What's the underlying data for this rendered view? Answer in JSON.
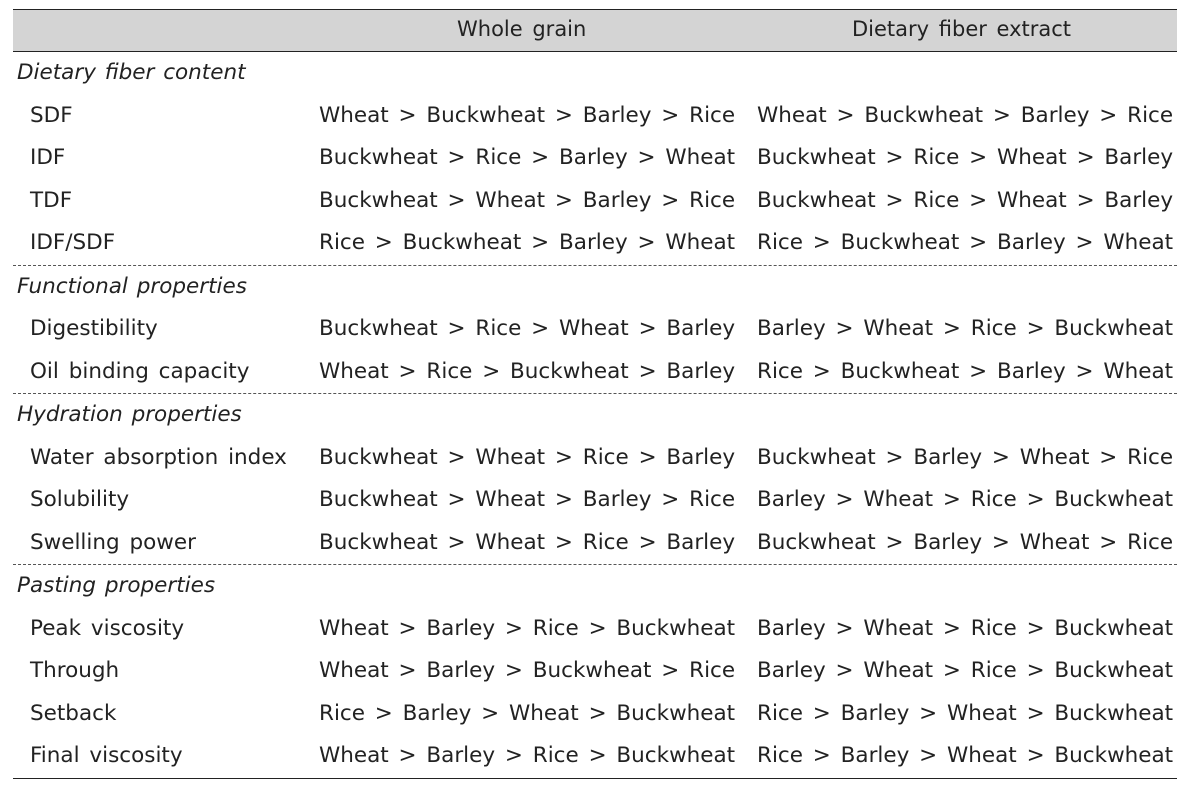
{
  "header": {
    "col_label": "",
    "col1": "Whole grain",
    "col2": "Dietary fiber extract"
  },
  "sections": [
    {
      "title": "Dietary fiber content",
      "rows": [
        {
          "label": "SDF",
          "whole": "Wheat > Buckwheat > Barley > Rice",
          "extract": "Wheat > Buckwheat > Barley > Rice"
        },
        {
          "label": "IDF",
          "whole": "Buckwheat > Rice > Barley > Wheat",
          "extract": "Buckwheat > Rice > Wheat > Barley"
        },
        {
          "label": "TDF",
          "whole": "Buckwheat > Wheat > Barley > Rice",
          "extract": "Buckwheat > Rice > Wheat > Barley"
        },
        {
          "label": "IDF/SDF",
          "whole": "Rice > Buckwheat > Barley > Wheat",
          "extract": "Rice > Buckwheat > Barley > Wheat"
        }
      ]
    },
    {
      "title": "Functional properties",
      "rows": [
        {
          "label": "Digestibility",
          "whole": "Buckwheat > Rice > Wheat > Barley",
          "extract": "Barley > Wheat > Rice > Buckwheat"
        },
        {
          "label": "Oil binding capacity",
          "whole": "Wheat > Rice > Buckwheat > Barley",
          "extract": "Rice > Buckwheat > Barley > Wheat"
        }
      ]
    },
    {
      "title": "Hydration properties",
      "rows": [
        {
          "label": "Water absorption index",
          "whole": "Buckwheat > Wheat > Rice > Barley",
          "extract": "Buckwheat > Barley > Wheat > Rice"
        },
        {
          "label": "Solubility",
          "whole": "Buckwheat > Wheat > Barley > Rice",
          "extract": "Barley > Wheat > Rice > Buckwheat"
        },
        {
          "label": "Swelling power",
          "whole": "Buckwheat > Wheat > Rice > Barley",
          "extract": "Buckwheat > Barley > Wheat > Rice"
        }
      ]
    },
    {
      "title": "Pasting properties",
      "rows": [
        {
          "label": "Peak viscosity",
          "whole": "Wheat > Barley > Rice > Buckwheat",
          "extract": "Barley > Wheat > Rice > Buckwheat"
        },
        {
          "label": "Through",
          "whole": "Wheat > Barley > Buckwheat > Rice",
          "extract": "Barley > Wheat > Rice > Buckwheat"
        },
        {
          "label": "Setback",
          "whole": "Rice > Barley > Wheat > Buckwheat",
          "extract": "Rice > Barley > Wheat > Buckwheat"
        },
        {
          "label": "Final viscosity",
          "whole": "Wheat > Barley > Rice > Buckwheat",
          "extract": "Rice > Barley > Wheat > Buckwheat"
        }
      ]
    }
  ]
}
